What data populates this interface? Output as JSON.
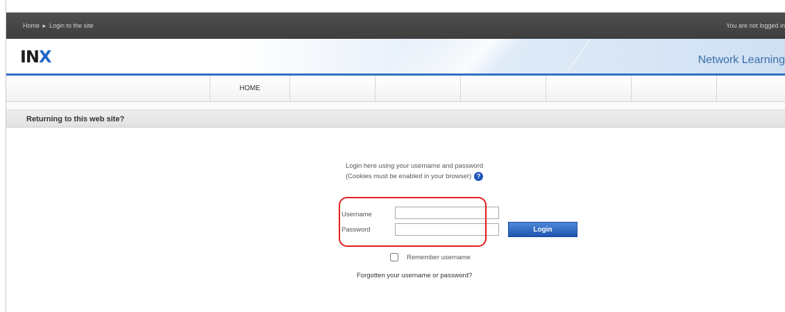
{
  "topbar": {
    "breadcrumb_home": "Home",
    "breadcrumb_separator": "►",
    "breadcrumb_current": "Login to the site",
    "status": "You are not logged in"
  },
  "header": {
    "logo_main": "IN",
    "logo_accent": "X",
    "tagline": "Network Learning"
  },
  "nav": {
    "items": [
      "HOME",
      "",
      "",
      "",
      "",
      "",
      ""
    ]
  },
  "section": {
    "title": "Returning to this web site?"
  },
  "login": {
    "intro_line1": "Login here using your username and password",
    "intro_line2": "(Cookies must be enabled in your browser)",
    "help_icon_glyph": "?",
    "username_label": "Username",
    "username_value": "",
    "password_label": "Password",
    "password_value": "",
    "login_button": "Login",
    "remember_label": "Remember username",
    "remember_checked": false,
    "forgot_link": "Forgotten your username or password?"
  },
  "colors": {
    "accent": "#1f63c6",
    "highlight": "#e21d1d",
    "topbar": "#444444"
  }
}
